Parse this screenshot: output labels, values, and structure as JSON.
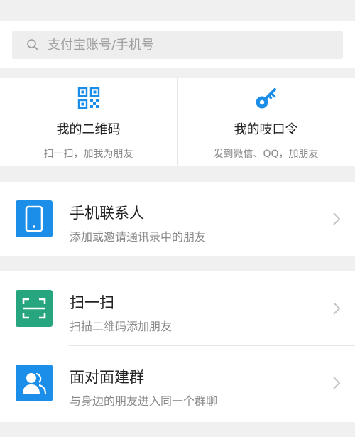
{
  "search": {
    "placeholder": "支付宝账号/手机号",
    "icon": "search-icon"
  },
  "features": [
    {
      "title": "我的二维码",
      "subtitle": "扫一扫，加我为朋友",
      "icon": "qr-code-icon"
    },
    {
      "title": "我的吱口令",
      "subtitle": "发到微信、QQ，加朋友",
      "icon": "key-icon"
    }
  ],
  "items": [
    {
      "title": "手机联系人",
      "subtitle": "添加或邀请通讯录中的朋友",
      "icon": "phone-icon"
    },
    {
      "title": "扫一扫",
      "subtitle": "扫描二维码添加朋友",
      "icon": "scan-icon"
    },
    {
      "title": "面对面建群",
      "subtitle": "与身边的朋友进入同一个群聊",
      "icon": "group-person-icon"
    }
  ],
  "colors": {
    "brand_blue": "#1a8ee8",
    "scan_green": "#27a57e",
    "background": "#f0f0f0"
  }
}
